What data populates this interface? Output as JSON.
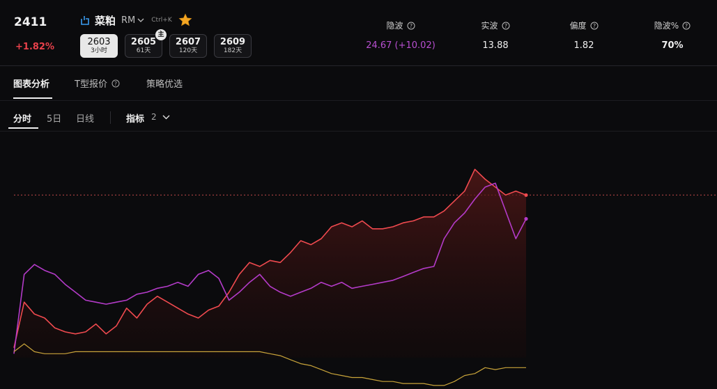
{
  "header": {
    "price": "2411",
    "change": "+1.82%",
    "symbol_name": "菜粕",
    "symbol_code": "RM",
    "shortcut": "Ctrl+K",
    "contracts": [
      {
        "code": "2603",
        "sub": "3小时",
        "active": true
      },
      {
        "code": "2605",
        "sub": "61天",
        "badge": "主"
      },
      {
        "code": "2607",
        "sub": "120天"
      },
      {
        "code": "2609",
        "sub": "182天"
      }
    ],
    "metrics": [
      {
        "label": "隐波",
        "value": "24.67",
        "change": "(+10.02)"
      },
      {
        "label": "实波",
        "value": "13.88"
      },
      {
        "label": "偏度",
        "value": "1.82"
      },
      {
        "label": "隐波%",
        "value": "70%"
      }
    ]
  },
  "tabs": [
    "图表分析",
    "T型报价",
    "策略优选"
  ],
  "subtabs": [
    "分时",
    "5日",
    "日线"
  ],
  "indicator": {
    "label": "指标",
    "count": "2"
  },
  "colors": {
    "red": "#f04a4f",
    "purple": "#b43bc9",
    "yellow": "#c9a43a",
    "up": "#e8414b"
  },
  "chart_data": {
    "type": "line",
    "x": [
      0,
      2,
      4,
      6,
      8,
      10,
      12,
      14,
      16,
      18,
      20,
      22,
      24,
      26,
      28,
      30,
      32,
      34,
      36,
      38,
      40,
      42,
      44,
      46,
      48,
      50,
      52,
      54,
      56,
      58,
      60,
      62,
      64,
      66,
      68,
      70,
      72,
      74,
      76,
      78,
      80,
      82,
      84,
      86,
      88,
      90,
      92,
      94,
      96,
      98,
      100
    ],
    "reference_line": 0.82,
    "series": [
      {
        "color": "#f04a4f",
        "values": [
          0.05,
          0.28,
          0.22,
          0.2,
          0.15,
          0.13,
          0.12,
          0.13,
          0.17,
          0.12,
          0.16,
          0.25,
          0.2,
          0.27,
          0.31,
          0.28,
          0.25,
          0.22,
          0.2,
          0.24,
          0.26,
          0.33,
          0.42,
          0.48,
          0.46,
          0.49,
          0.48,
          0.53,
          0.59,
          0.57,
          0.6,
          0.66,
          0.68,
          0.66,
          0.69,
          0.65,
          0.65,
          0.66,
          0.68,
          0.69,
          0.71,
          0.71,
          0.74,
          0.79,
          0.84,
          0.95,
          0.9,
          0.86,
          0.82,
          0.84,
          0.82
        ]
      },
      {
        "color": "#b43bc9",
        "values": [
          0.02,
          0.42,
          0.47,
          0.44,
          0.42,
          0.37,
          0.33,
          0.29,
          0.28,
          0.27,
          0.28,
          0.29,
          0.32,
          0.33,
          0.35,
          0.36,
          0.38,
          0.36,
          0.42,
          0.44,
          0.4,
          0.29,
          0.33,
          0.38,
          0.42,
          0.36,
          0.33,
          0.31,
          0.33,
          0.35,
          0.38,
          0.36,
          0.38,
          0.35,
          0.36,
          0.37,
          0.38,
          0.39,
          0.41,
          0.43,
          0.45,
          0.46,
          0.6,
          0.68,
          0.73,
          0.8,
          0.86,
          0.88,
          0.74,
          0.6,
          0.7
        ]
      },
      {
        "color": "#c9a43a",
        "values": [
          0.03,
          0.07,
          0.03,
          0.02,
          0.02,
          0.02,
          0.03,
          0.03,
          0.03,
          0.03,
          0.03,
          0.03,
          0.03,
          0.03,
          0.03,
          0.03,
          0.03,
          0.03,
          0.03,
          0.03,
          0.03,
          0.03,
          0.03,
          0.03,
          0.03,
          0.02,
          0.01,
          -0.01,
          -0.03,
          -0.04,
          -0.06,
          -0.08,
          -0.09,
          -0.1,
          -0.1,
          -0.11,
          -0.12,
          -0.12,
          -0.13,
          -0.13,
          -0.13,
          -0.14,
          -0.14,
          -0.12,
          -0.09,
          -0.08,
          -0.05,
          -0.06,
          -0.05,
          -0.05,
          -0.05
        ]
      }
    ]
  }
}
